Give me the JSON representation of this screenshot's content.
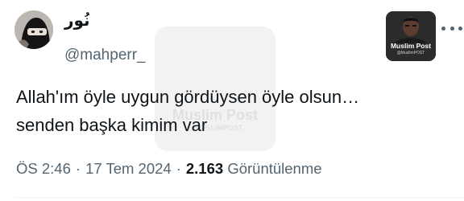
{
  "author": {
    "display_name": "نُور",
    "handle": "@mahperr_"
  },
  "more_icon": "more-horizontal-icon",
  "badge": {
    "title": "Muslim Post",
    "subtitle": "@MuslimPOST"
  },
  "watermark": {
    "title": "Muslim Post",
    "subtitle": "@MUSLIMPOST"
  },
  "tweet": {
    "lines": [
      "Allah'ım öyle uygun gördüysen öyle olsun…",
      "senden başka kimim var"
    ]
  },
  "meta": {
    "time": "ÖS 2:46",
    "separator": "·",
    "date": "17 Tem 2024",
    "views_count": "2.163",
    "views_label": "Görüntülenme"
  },
  "colors": {
    "text_primary": "#0f1419",
    "text_secondary": "#536471",
    "divider": "#eff3f4"
  }
}
